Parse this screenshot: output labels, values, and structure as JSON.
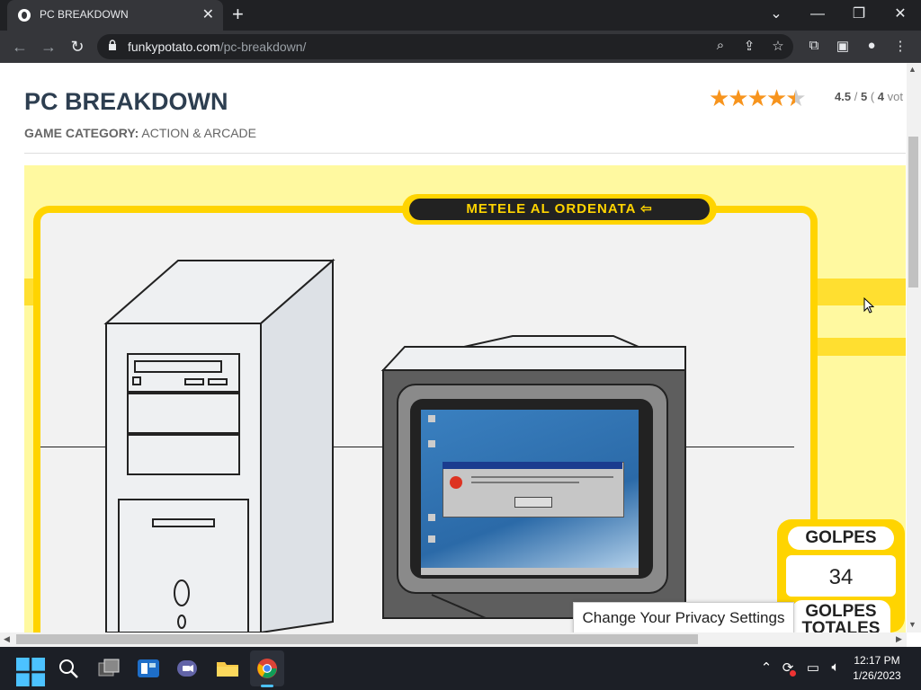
{
  "browser": {
    "tab_title": "PC BREAKDOWN",
    "url_domain": "funkypotato.com",
    "url_path": "/pc-breakdown/"
  },
  "page": {
    "title": "PC BREAKDOWN",
    "category_label": "GAME CATEGORY:",
    "category_value": "ACTION & ARCADE",
    "stars_shown": 4.5,
    "rating_value": "4.5",
    "rating_sep": "/",
    "rating_max": "5",
    "rating_open": "(",
    "votes_count": "4",
    "votes_label": "vot"
  },
  "game": {
    "banner": "METELE AL ORDENATA",
    "score_label": "GOLPES",
    "score_value": "34",
    "total_label": "GOLPES TOTALES"
  },
  "privacy": {
    "label": "Change Your Privacy Settings"
  },
  "taskbar": {
    "time": "12:17 PM",
    "date": "1/26/2023"
  },
  "colors": {
    "accent_yellow": "#ffd400",
    "title_color": "#2d3e50",
    "star_color": "#f7941d"
  }
}
